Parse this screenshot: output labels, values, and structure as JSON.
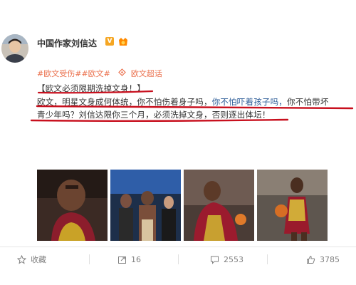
{
  "author": {
    "name": "中国作家刘信达",
    "verified_mark": "V"
  },
  "tags": {
    "topic1": "#欧文受伤#",
    "topic2": "#欧文#",
    "super_topic": "欧文超话"
  },
  "post": {
    "line1": "【欧文必须限期洗掉文身！】",
    "line2_a": "欧文，明星文身成何体统，你不怕伤着身子吗，",
    "line2_b": "你不怕吓着孩子吗，",
    "line2_c": "你不怕带坏",
    "line3": "青少年吗？刘信达限你三个月，必须洗掉文身，否则逐出体坛！"
  },
  "actions": {
    "favorite_label": "收藏",
    "repost_count": "16",
    "comment_count": "2553",
    "like_count": "3785"
  },
  "colors": {
    "accent": "#eb7350",
    "link": "#2a5a96",
    "annotation": "#c8101e"
  },
  "icons": [
    "star-icon",
    "repost-icon",
    "comment-icon",
    "like-icon",
    "super-topic-icon",
    "verified-icon"
  ]
}
